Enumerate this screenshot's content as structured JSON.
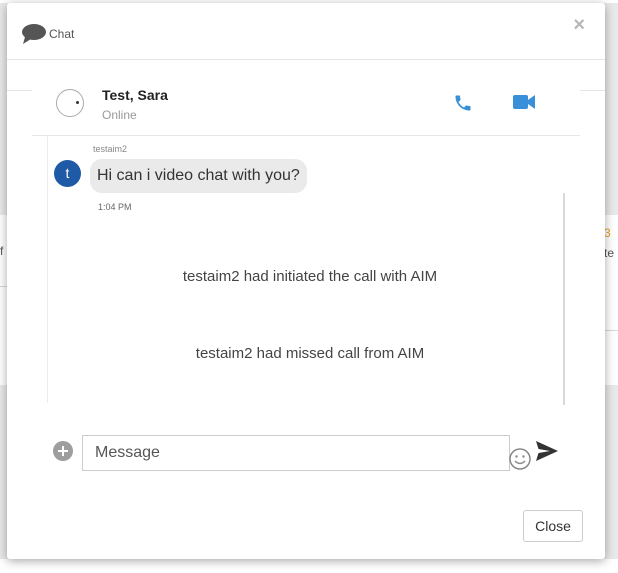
{
  "modal": {
    "title": "Chat",
    "close_x": "×"
  },
  "contact": {
    "name": "Test, Sara",
    "status": "Online"
  },
  "conversation": {
    "sender": "testaim2",
    "avatar_initial": "t",
    "message": "Hi can i video chat with you?",
    "time": "1:04 PM",
    "system_messages": [
      "testaim2 had initiated the call with AIM",
      "testaim2 had missed call from AIM"
    ]
  },
  "composer": {
    "placeholder": "Message"
  },
  "footer": {
    "close_label": "Close"
  },
  "background": {
    "left_fragment": "f",
    "right_fragment": "te",
    "right_badge": "3"
  },
  "colors": {
    "accent_blue": "#3a8fd9",
    "avatar_blue": "#1f5aa6",
    "badge_orange": "#e6a023"
  },
  "icons": [
    "chat-bubble-icon",
    "phone-icon",
    "video-camera-icon",
    "add-circle-icon",
    "emoji-icon",
    "send-icon"
  ]
}
